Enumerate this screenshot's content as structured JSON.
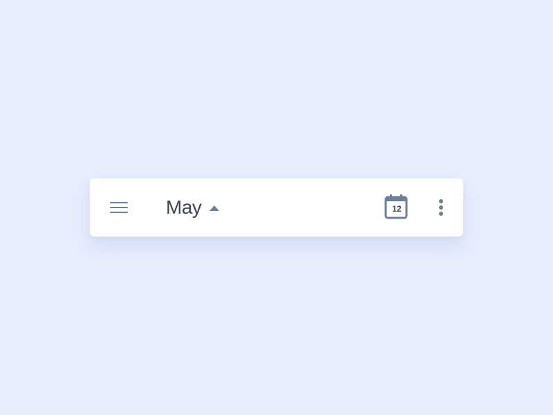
{
  "app_bar": {
    "month_label": "May",
    "today_day": "12"
  },
  "icons": {
    "menu": "hamburger-menu-icon",
    "month_toggle": "caret-up-icon",
    "today": "calendar-icon",
    "more": "more-vertical-icon"
  },
  "colors": {
    "background": "#e8eefe",
    "surface": "#ffffff",
    "icon": "#6b7f96",
    "text": "#3c4656"
  }
}
